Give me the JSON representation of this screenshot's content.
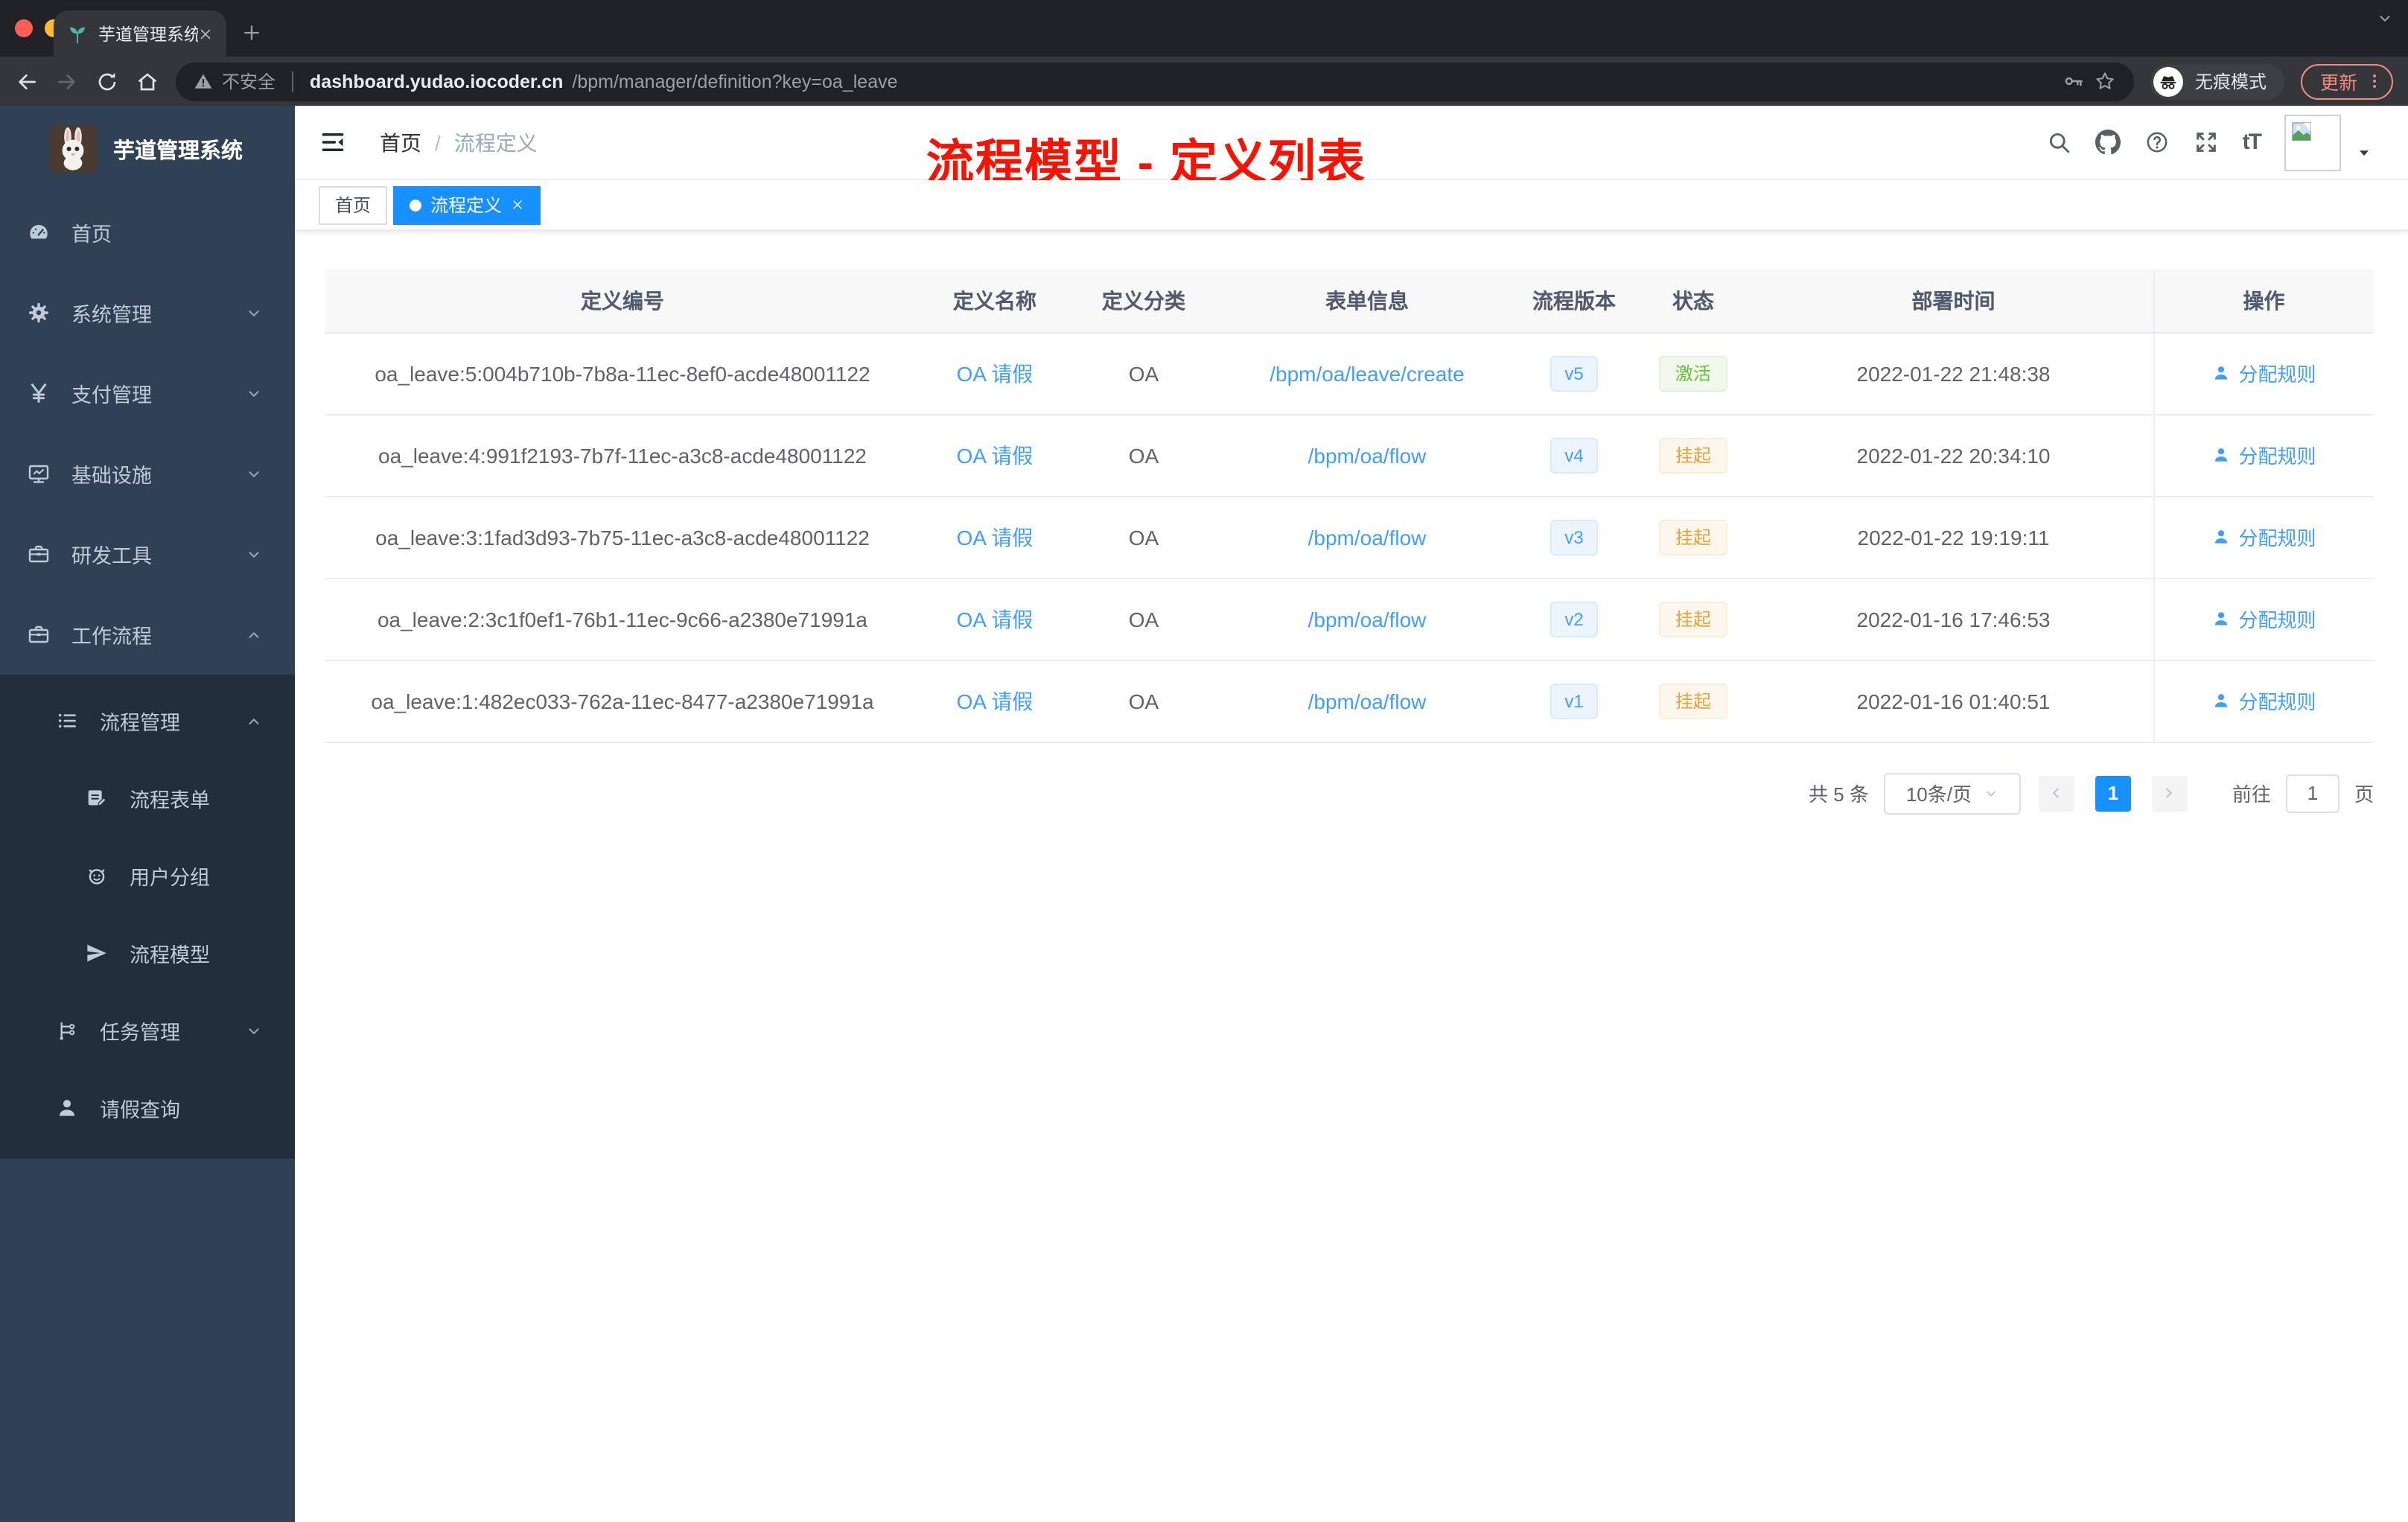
{
  "colors": {
    "primary": "#1890ff",
    "link": "#409eff",
    "success": "#67c23a",
    "warning": "#e6a23c",
    "annotation_red": "#fa1200",
    "sidebar_bg": "#304156",
    "submenu_bg": "#232e3d",
    "update_pill": "#f28b82"
  },
  "browser": {
    "tab_title": "芋道管理系统",
    "security_label": "不安全",
    "url_host": "dashboard.yudao.iocoder.cn",
    "url_path": "/bpm/manager/definition?key=oa_leave",
    "incognito_label": "无痕模式",
    "update_label": "更新"
  },
  "sidebar": {
    "app_title": "芋道管理系统",
    "items": [
      {
        "label": "首页",
        "icon": "dashboard-icon",
        "level": 1,
        "group": false,
        "expand": null
      },
      {
        "label": "系统管理",
        "icon": "gear-icon",
        "level": 1,
        "group": false,
        "expand": "down"
      },
      {
        "label": "支付管理",
        "icon": "yen-icon",
        "level": 1,
        "group": false,
        "expand": "down"
      },
      {
        "label": "基础设施",
        "icon": "monitor-icon",
        "level": 1,
        "group": false,
        "expand": "down"
      },
      {
        "label": "研发工具",
        "icon": "toolbox-icon",
        "level": 1,
        "group": false,
        "expand": "down"
      },
      {
        "label": "工作流程",
        "icon": "briefcase-icon",
        "level": 1,
        "group": false,
        "expand": "up"
      },
      {
        "label": "流程管理",
        "icon": "list-icon",
        "level": 2,
        "group": true,
        "expand": "up"
      },
      {
        "label": "流程表单",
        "icon": "form-icon",
        "level": 3,
        "group": true,
        "expand": null
      },
      {
        "label": "用户分组",
        "icon": "user-group-icon",
        "level": 3,
        "group": true,
        "expand": null
      },
      {
        "label": "流程模型",
        "icon": "paper-plane-icon",
        "level": 3,
        "group": true,
        "expand": null
      },
      {
        "label": "任务管理",
        "icon": "tree-icon",
        "level": 2,
        "group": true,
        "expand": "down"
      },
      {
        "label": "请假查询",
        "icon": "user-icon",
        "level": 2,
        "group": true,
        "expand": null
      }
    ]
  },
  "header": {
    "breadcrumb_home": "首页",
    "breadcrumb_sep": "/",
    "breadcrumb_current": "流程定义",
    "annotation": "流程模型 - 定义列表",
    "font_size_icon_label": "tT"
  },
  "tags": [
    {
      "label": "首页",
      "active": false,
      "closable": false
    },
    {
      "label": "流程定义",
      "active": true,
      "closable": true
    }
  ],
  "table": {
    "columns": [
      "定义编号",
      "定义名称",
      "定义分类",
      "表单信息",
      "流程版本",
      "状态",
      "部署时间",
      "操作"
    ],
    "rows": [
      {
        "id": "oa_leave:5:004b710b-7b8a-11ec-8ef0-acde48001122",
        "name": "OA 请假",
        "category": "OA",
        "form": "/bpm/oa/leave/create",
        "version": "v5",
        "status": "激活",
        "status_type": "success",
        "deploy_time": "2022-01-22 21:48:38",
        "action": "分配规则"
      },
      {
        "id": "oa_leave:4:991f2193-7b7f-11ec-a3c8-acde48001122",
        "name": "OA 请假",
        "category": "OA",
        "form": "/bpm/oa/flow",
        "version": "v4",
        "status": "挂起",
        "status_type": "warning",
        "deploy_time": "2022-01-22 20:34:10",
        "action": "分配规则"
      },
      {
        "id": "oa_leave:3:1fad3d93-7b75-11ec-a3c8-acde48001122",
        "name": "OA 请假",
        "category": "OA",
        "form": "/bpm/oa/flow",
        "version": "v3",
        "status": "挂起",
        "status_type": "warning",
        "deploy_time": "2022-01-22 19:19:11",
        "action": "分配规则"
      },
      {
        "id": "oa_leave:2:3c1f0ef1-76b1-11ec-9c66-a2380e71991a",
        "name": "OA 请假",
        "category": "OA",
        "form": "/bpm/oa/flow",
        "version": "v2",
        "status": "挂起",
        "status_type": "warning",
        "deploy_time": "2022-01-16 17:46:53",
        "action": "分配规则"
      },
      {
        "id": "oa_leave:1:482ec033-762a-11ec-8477-a2380e71991a",
        "name": "OA 请假",
        "category": "OA",
        "form": "/bpm/oa/flow",
        "version": "v1",
        "status": "挂起",
        "status_type": "warning",
        "deploy_time": "2022-01-16 01:40:51",
        "action": "分配规则"
      }
    ]
  },
  "pagination": {
    "total_label": "共 5 条",
    "page_size_label": "10条/页",
    "current_page": "1",
    "goto_label": "前往",
    "goto_value": "1",
    "page_unit_label": "页"
  }
}
